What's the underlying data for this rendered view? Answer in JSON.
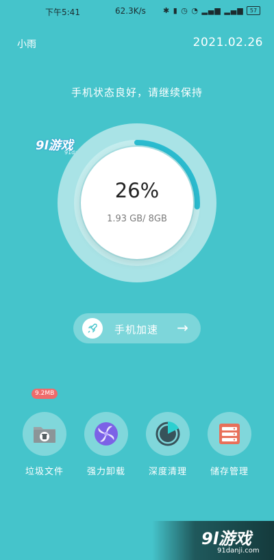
{
  "status_bar": {
    "time": "下午5:41",
    "network_speed": "62.3K/s",
    "icons": "✱ ▮ ◷ ◔ ▂▄▆ ▂▄▆",
    "battery": "57"
  },
  "header": {
    "user_name": "小雨",
    "date": "2021.02.26"
  },
  "status_message": "手机状态良好，请继续保持",
  "memory_gauge": {
    "percent_label": "26%",
    "percent_value": 0.26,
    "usage_text": "1.93 GB/ 8GB",
    "accent_color": "#2bbcd0"
  },
  "speed_button": {
    "label": "手机加速",
    "arrow": "→"
  },
  "junk_badge": "9.2MB",
  "tools": [
    {
      "label": "垃圾文件",
      "icon": "trash-icon"
    },
    {
      "label": "强力卸载",
      "icon": "pinwheel-icon"
    },
    {
      "label": "深度清理",
      "icon": "pie-clean-icon"
    },
    {
      "label": "储存管理",
      "icon": "storage-icon"
    }
  ],
  "watermark_top": {
    "logo_mark": "9l",
    "logo_text": "游戏",
    "url": "91danji.com"
  },
  "watermark_bottom": {
    "logo": "9l游戏",
    "url": "91danji.com"
  }
}
